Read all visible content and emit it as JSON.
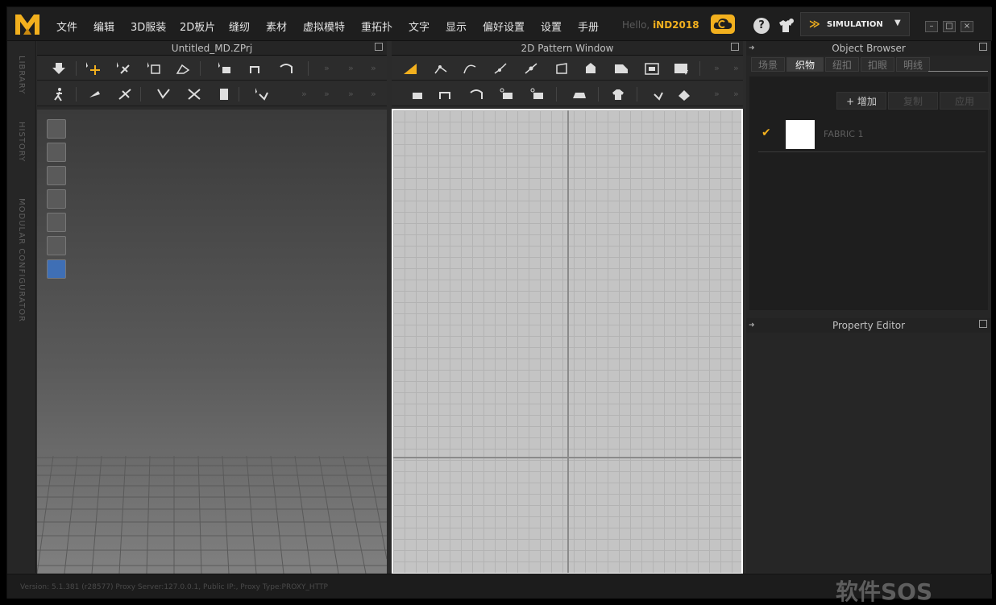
{
  "menubar": {
    "items": [
      "文件",
      "编辑",
      "3D服装",
      "2D板片",
      "缝纫",
      "素材",
      "虚拟模特",
      "重拓扑",
      "文字",
      "显示",
      "偏好设置",
      "设置",
      "手册"
    ],
    "hello_prefix": "Hello,",
    "username": "iND2018",
    "help_label": "?",
    "simulation_label": "SIMULATION",
    "simulation_chevron": "≫",
    "simulation_dropdown": "▼",
    "window_controls": [
      "–",
      "□",
      "×"
    ]
  },
  "sidebar": {
    "tabs": [
      "LIBRARY",
      "HISTORY",
      "MODULAR CONFIGURATOR"
    ]
  },
  "panels": {
    "view3d_title": "Untitled_MD.ZPrj",
    "view2d_title": "2D Pattern Window",
    "more_glyph": "»"
  },
  "object_browser": {
    "title": "Object Browser",
    "tabs": [
      "场景",
      "织物",
      "纽扣",
      "扣眼",
      "明线"
    ],
    "active_tab": "织物",
    "add_button": "+ 增加",
    "copy_button": "复制",
    "apply_button": "应用",
    "fabric_check": "✔",
    "fabric_name": "FABRIC 1",
    "fabric_color": "#ffffff"
  },
  "property_editor": {
    "title": "Property Editor"
  },
  "statusbar": {
    "text": "Version: 5.1.381 (r28577)     Proxy Server:127.0.0.1, Public IP:, Proxy Type:PROXY_HTTP",
    "watermark": "软件SOS"
  },
  "colors": {
    "accent": "#f2b01e",
    "background": "#2b2b2b",
    "grid": "#c4c4c4"
  },
  "icons": {
    "logo": "md-logo",
    "cloud": "cloud-icon",
    "help": "help-icon",
    "avatar_shirt": "shirt-avatar-icon"
  }
}
